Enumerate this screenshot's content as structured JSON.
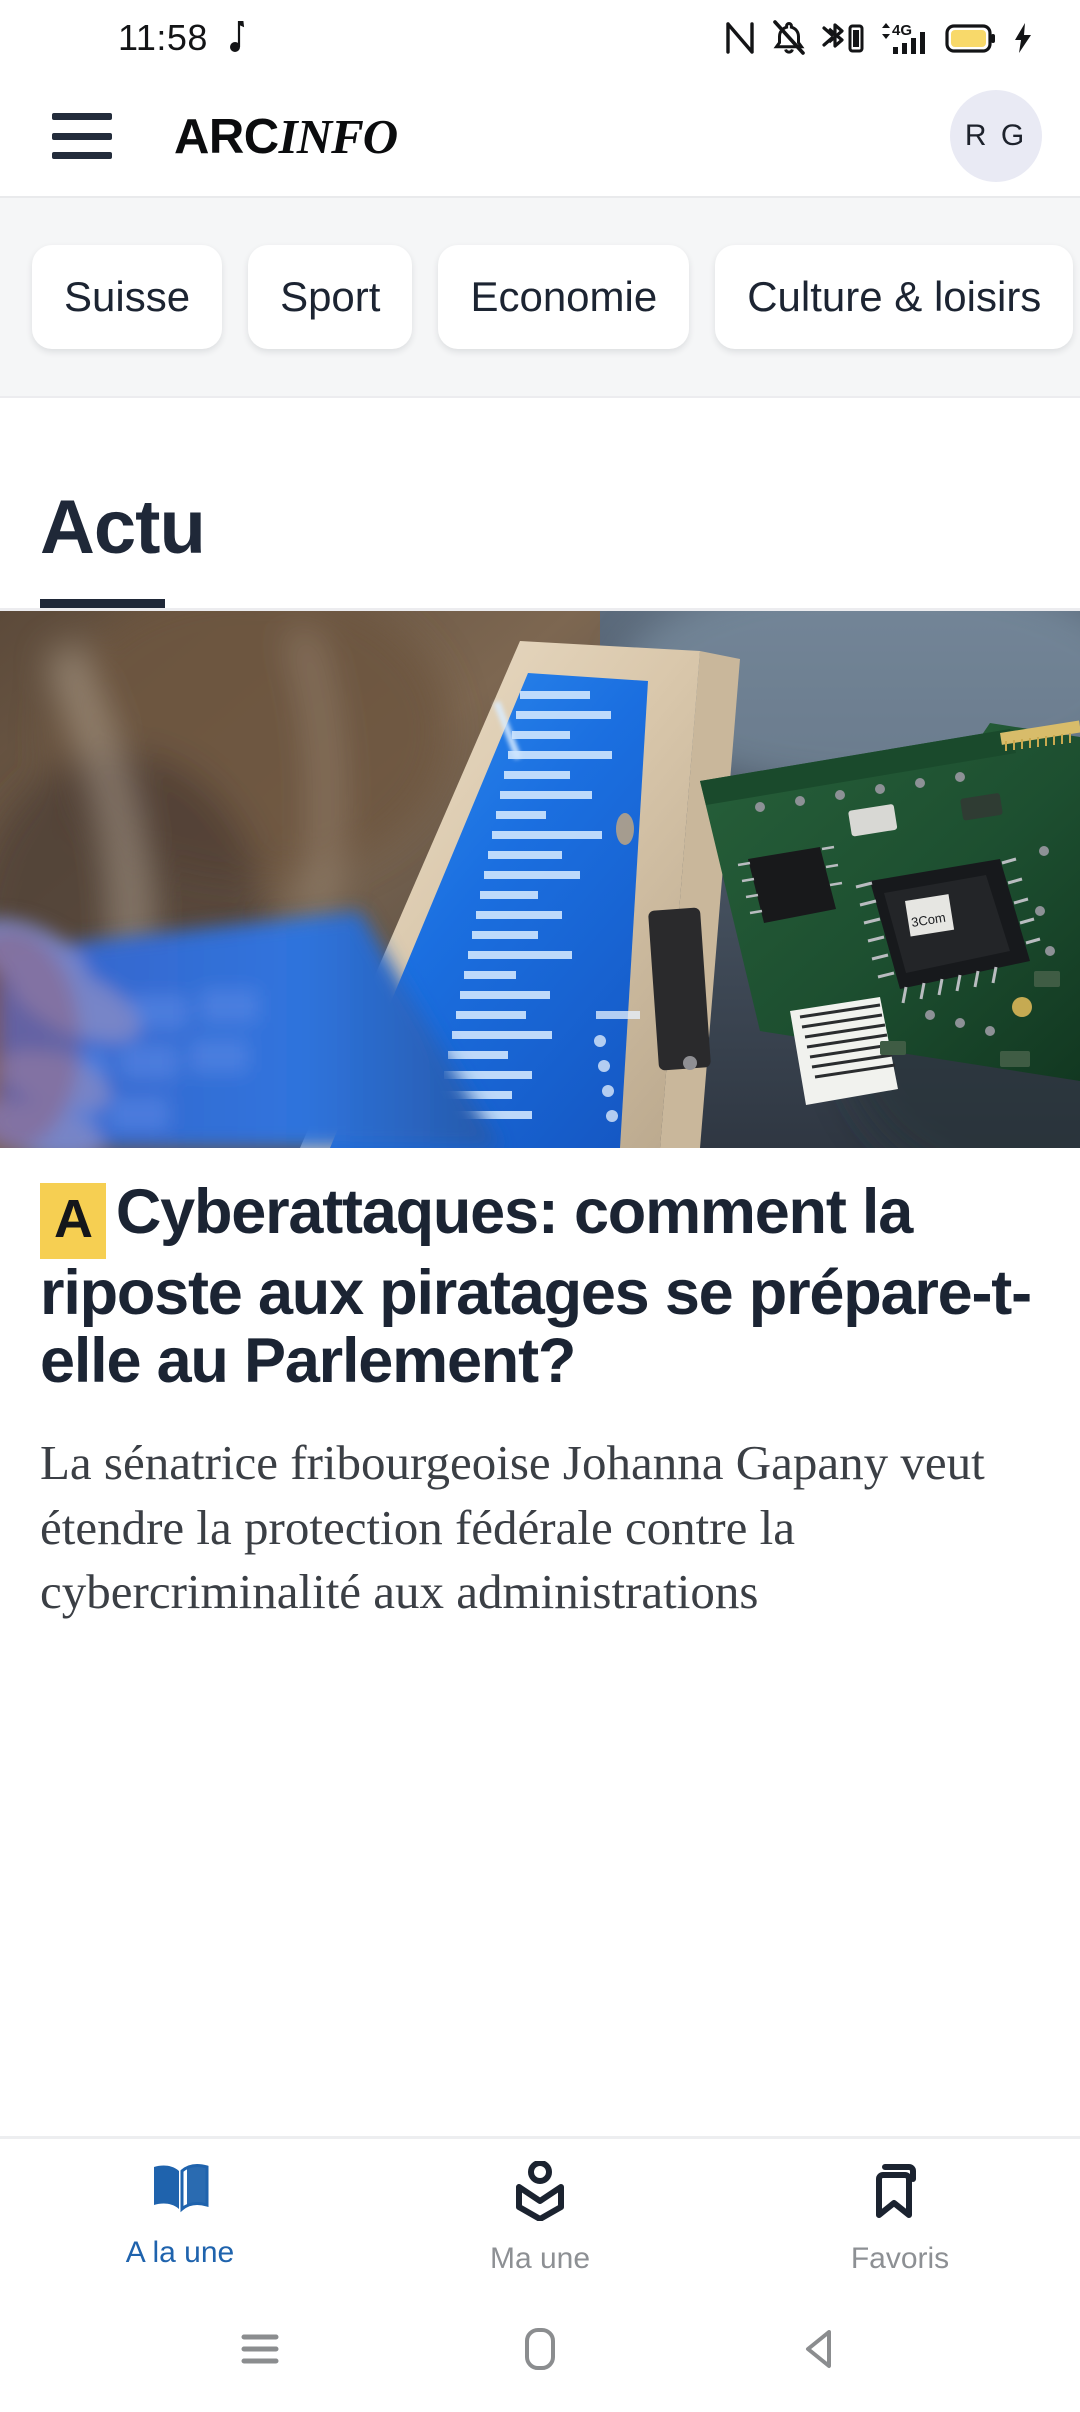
{
  "status_bar": {
    "time": "11:58",
    "left_icons": [
      "music-note-icon"
    ],
    "right_icons": [
      "nfc-icon",
      "notifications-off-icon",
      "bluetooth-battery-icon",
      "mobile-data-4g-icon",
      "signal-bars-icon",
      "battery-icon",
      "charging-bolt-icon"
    ],
    "network_label": "4G",
    "battery_color": "#f8d96a"
  },
  "header": {
    "menu_label": "Menu",
    "brand_arc": "ARC",
    "brand_info": "INFO",
    "avatar_initials": "R G",
    "avatar_bg": "#e9eaf4"
  },
  "categories": {
    "chips": [
      {
        "label": "Suisse"
      },
      {
        "label": "Sport"
      },
      {
        "label": "Economie"
      },
      {
        "label": "Culture & loisirs"
      }
    ]
  },
  "section": {
    "active_tab": "Actu",
    "accent": "#1f2838"
  },
  "article": {
    "badge": "A",
    "badge_color": "#f6cf52",
    "headline": "Cyberattaques: comment la riposte aux piratages se prépare-t-elle au Parlement?",
    "lead": "La sénatrice fribourgeoise Johanna Gapany veut étendre la protection fédérale  contre la cybercriminalité aux administrations",
    "image_alt": "laptop-circuit-board-photo"
  },
  "bottom_nav": {
    "active_color": "#1f63ad",
    "inactive_color": "#8d9094",
    "items": [
      {
        "label": "A la une",
        "icon": "open-book-icon",
        "active": true
      },
      {
        "label": "Ma une",
        "icon": "person-book-icon",
        "active": false
      },
      {
        "label": "Favoris",
        "icon": "bookmark-icon",
        "active": false
      }
    ]
  },
  "system_nav": {
    "items": [
      {
        "name": "recents-button",
        "icon": "recents-icon"
      },
      {
        "name": "home-button",
        "icon": "home-icon"
      },
      {
        "name": "back-button",
        "icon": "back-icon"
      }
    ]
  }
}
